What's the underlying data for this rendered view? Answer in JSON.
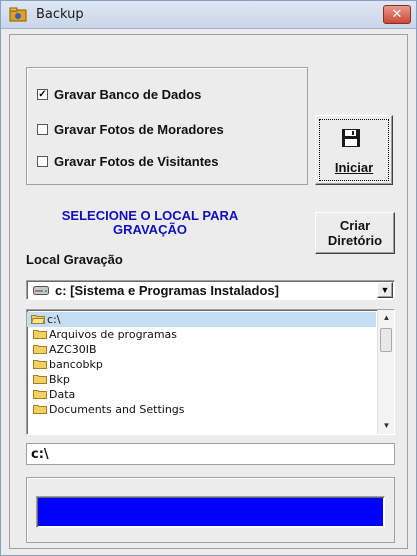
{
  "window": {
    "title": "Backup",
    "close_glyph": "✕",
    "app_icon": "app-icon"
  },
  "options": {
    "items": [
      {
        "label": "Gravar Banco de Dados",
        "checked": true
      },
      {
        "label": "Gravar Fotos de Moradores",
        "checked": false
      },
      {
        "label": "Gravar Fotos de Visitantes",
        "checked": false
      }
    ]
  },
  "buttons": {
    "iniciar_label": "Iniciar",
    "iniciar_icon": "floppy-disk-icon",
    "criar_label_line1": "Criar",
    "criar_label_line2": "Diretório"
  },
  "message": {
    "line1": "SELECIONE O LOCAL PARA",
    "line2": "GRAVAÇÃO",
    "color": "#1010c0"
  },
  "local": {
    "label": "Local Gravação",
    "drive_selected": "c: [Sistema e Programas Instalados]",
    "drive_icon": "hard-drive-icon"
  },
  "directories": [
    {
      "name": "c:\\",
      "selected": true,
      "open": true
    },
    {
      "name": "Arquivos de programas"
    },
    {
      "name": "AZC30IB"
    },
    {
      "name": "bancobkp"
    },
    {
      "name": "Bkp"
    },
    {
      "name": "Data"
    },
    {
      "name": "Documents and Settings"
    }
  ],
  "path_value": "c:\\",
  "progress": {
    "fraction": 1.0,
    "color": "#0000ff"
  }
}
